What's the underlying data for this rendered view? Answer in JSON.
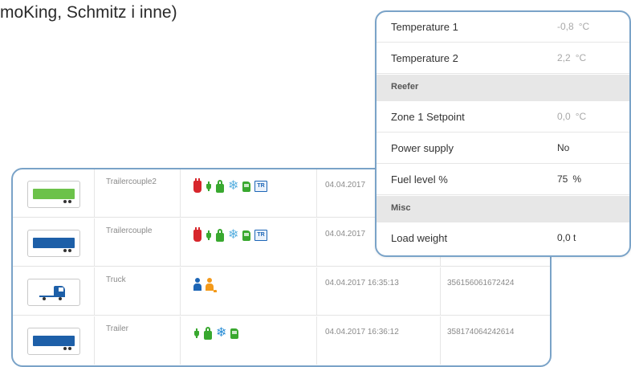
{
  "header": {
    "text": "moKing, Schmitz i inne)"
  },
  "vehicles": [
    {
      "kind": "trailer-green",
      "name": "Trailercouple2",
      "status_icons": [
        "plug-red-icon",
        "plug-green-icon",
        "lock-green-icon",
        "snowflake-icon",
        "fuel-green-icon",
        "tr-icon"
      ],
      "tr_label": "TR",
      "date": "04.04.2017",
      "device_id": ""
    },
    {
      "kind": "trailer-blue",
      "name": "Trailercouple",
      "status_icons": [
        "plug-red-icon",
        "plug-green-icon",
        "lock-green-icon",
        "snowflake-icon",
        "fuel-green-icon",
        "tr-icon"
      ],
      "tr_label": "TR",
      "date": "04.04.2017",
      "device_id": ""
    },
    {
      "kind": "truck",
      "name": "Truck",
      "status_icons": [
        "person-blue-icon",
        "person-orange-icon"
      ],
      "date": "04.04.2017 16:35:13",
      "device_id": "356156061672424"
    },
    {
      "kind": "trailer-blue",
      "name": "Trailer",
      "status_icons": [
        "plug-green-icon",
        "lock-green-icon",
        "snowflake-icon",
        "fuel-green-icon"
      ],
      "date": "04.04.2017 16:36:12",
      "device_id": "358174064242614"
    }
  ],
  "sensors": {
    "rows": [
      {
        "label": "Temperature 1",
        "value": "-0,8",
        "unit": "°C"
      },
      {
        "label": "Temperature 2",
        "value": "2,2",
        "unit": "°C"
      },
      {
        "section": "Reefer"
      },
      {
        "label": "Zone 1 Setpoint",
        "value": "0,0",
        "unit": "°C"
      },
      {
        "label": "Power supply",
        "value": "No"
      },
      {
        "label": "Fuel level %",
        "value": "75",
        "unit": "%"
      },
      {
        "section": "Misc"
      },
      {
        "label": "Load weight",
        "value": "0,0 t"
      }
    ]
  },
  "colors": {
    "frame_border": "#7aa3c8",
    "trailer_green": "#6cc24a",
    "trailer_blue": "#1d5fa8",
    "status_red": "#d7262c",
    "status_green": "#39a82f",
    "snow_blue": "#5ab0e0",
    "driver_orange": "#f39a1b"
  }
}
